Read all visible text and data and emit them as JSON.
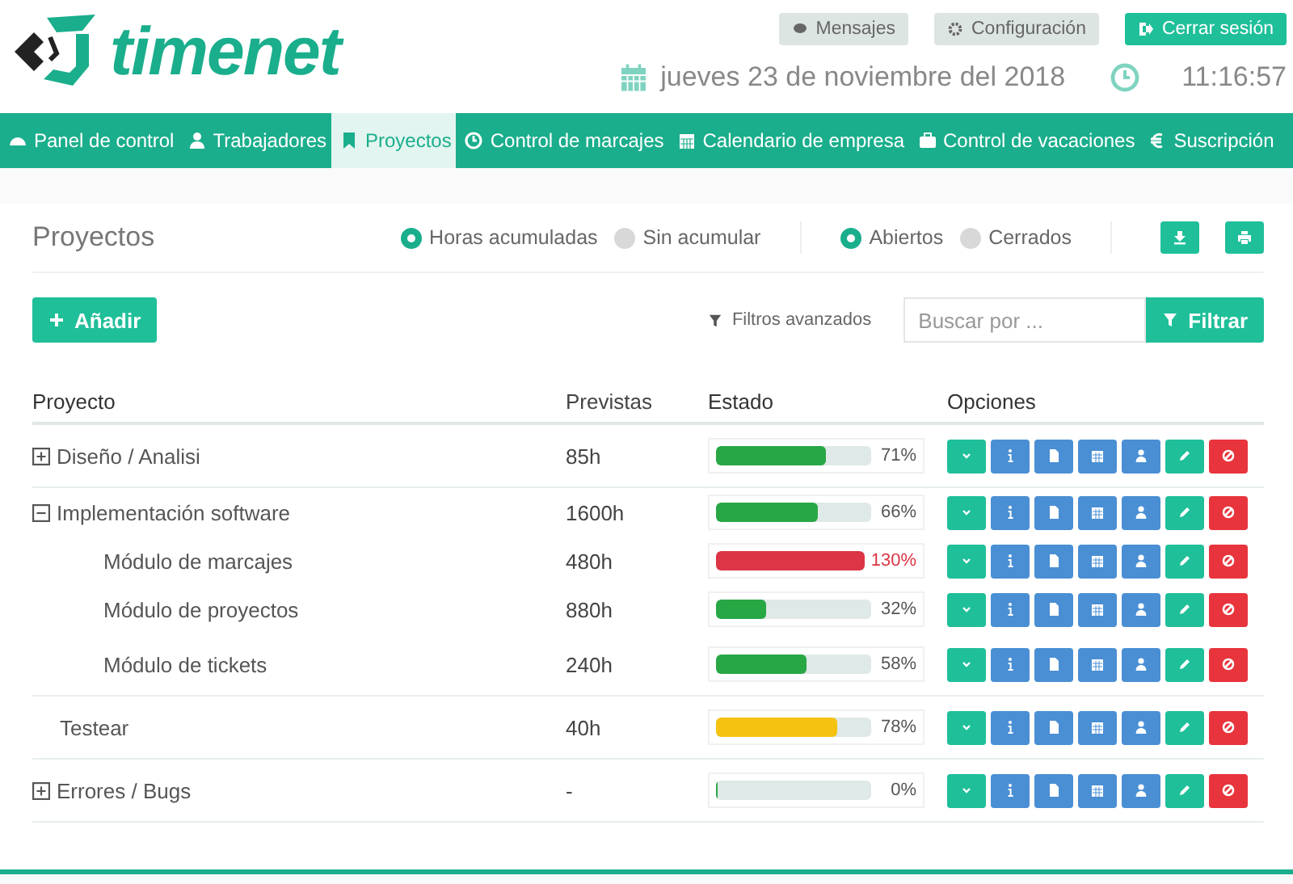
{
  "logo": {
    "text": "timenet"
  },
  "top_buttons": [
    {
      "label": "Mensajes",
      "kind": "plain"
    },
    {
      "label": "Configuración",
      "kind": "plain"
    },
    {
      "label": "Cerrar sesión",
      "kind": "primary"
    }
  ],
  "date": "jueves 23 de noviembre del 2018",
  "time": "11:16:57",
  "nav": [
    {
      "label": "Panel de control",
      "selected": false
    },
    {
      "label": "Trabajadores",
      "selected": false
    },
    {
      "label": "Proyectos",
      "selected": true
    },
    {
      "label": "Control de marcajes",
      "selected": false
    },
    {
      "label": "Calendario de empresa",
      "selected": false
    },
    {
      "label": "Control de vacaciones",
      "selected": false
    },
    {
      "label": "Suscripción",
      "selected": false
    }
  ],
  "page_title": "Proyectos",
  "hours_mode": [
    {
      "label": "Horas acumuladas",
      "selected": true
    },
    {
      "label": "Sin acumular",
      "selected": false
    }
  ],
  "status_filter": [
    {
      "label": "Abiertos",
      "selected": true
    },
    {
      "label": "Cerrados",
      "selected": false
    }
  ],
  "add_button": "Añadir",
  "advanced_filters": "Filtros avanzados",
  "search": {
    "placeholder": "Buscar por ..."
  },
  "filter_button": "Filtrar",
  "table": {
    "columns": [
      "Proyecto",
      "Previstas",
      "Estado",
      "Opciones"
    ],
    "rows": [
      {
        "name": "Diseño / Analisi",
        "expanded": false,
        "planned": "85h",
        "level": 0.71,
        "color": "#28a745",
        "reading": "71%",
        "overrun": false,
        "children": []
      },
      {
        "name": "Implementación software",
        "expanded": true,
        "planned": "1600h",
        "level": 0.66,
        "color": "#28a745",
        "reading": "66%",
        "overrun": false,
        "children": [
          {
            "name": "Módulo de marcajes",
            "planned": "480h",
            "level": 1,
            "color": "#dc3545",
            "reading": "130%",
            "overrun": true
          },
          {
            "name": "Módulo de proyectos",
            "planned": "880h",
            "level": 0.32,
            "color": "#28a745",
            "reading": "32%",
            "overrun": false
          },
          {
            "name": "Módulo de tickets",
            "planned": "240h",
            "level": 0.58,
            "color": "#28a745",
            "reading": "58%",
            "overrun": false
          }
        ]
      },
      {
        "name": "Testear",
        "planned": "40h",
        "level": 0.78,
        "color": "#f5c211",
        "reading": "78%",
        "overrun": false
      },
      {
        "name": "Errores / Bugs",
        "expanded": false,
        "planned": "-",
        "level": 0,
        "color": "#28a745",
        "reading": "0%",
        "overrun": false,
        "children": []
      }
    ]
  }
}
